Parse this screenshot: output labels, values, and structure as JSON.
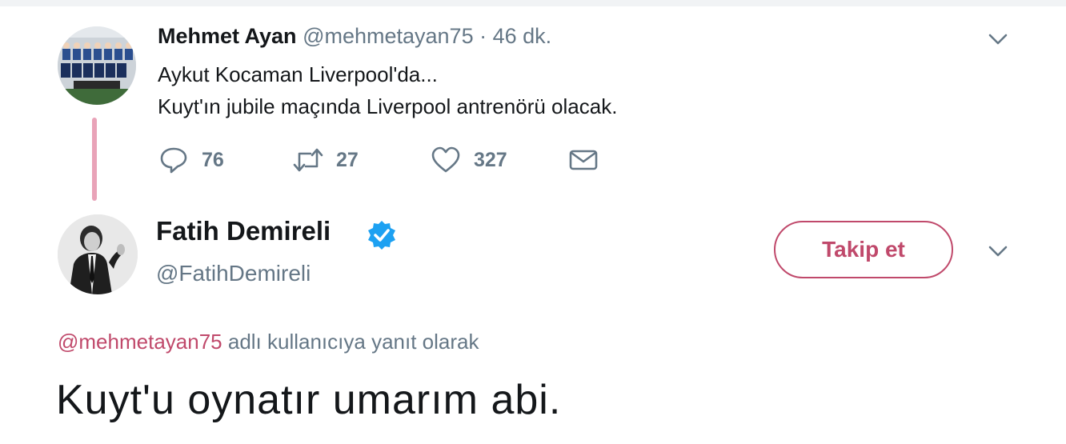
{
  "parent_tweet": {
    "name": "Mehmet Ayan",
    "handle": "@mehmetayan75",
    "separator": "·",
    "time": "46 dk.",
    "text_lines": [
      "Aykut Kocaman Liverpool'da...",
      "Kuyt'ın jubile maçında Liverpool antrenörü olacak."
    ],
    "actions": {
      "reply_count": "76",
      "retweet_count": "27",
      "like_count": "327"
    }
  },
  "reply_tweet": {
    "name": "Fatih Demireli",
    "handle": "@FatihDemireli",
    "follow_label": "Takip et",
    "reply_to_mention": "@mehmetayan75",
    "reply_to_suffix": "adlı kullanıcıya yanıt olarak",
    "text": "Kuyt'u oynatır umarım abi."
  },
  "colors": {
    "accent": "#c0496b",
    "thread_line": "#e9a3b8",
    "muted": "#657786",
    "verified": "#1da1f2"
  },
  "icons": [
    "chevron-down-icon",
    "reply-icon",
    "retweet-icon",
    "like-icon",
    "direct-message-icon",
    "verified-badge-icon"
  ]
}
